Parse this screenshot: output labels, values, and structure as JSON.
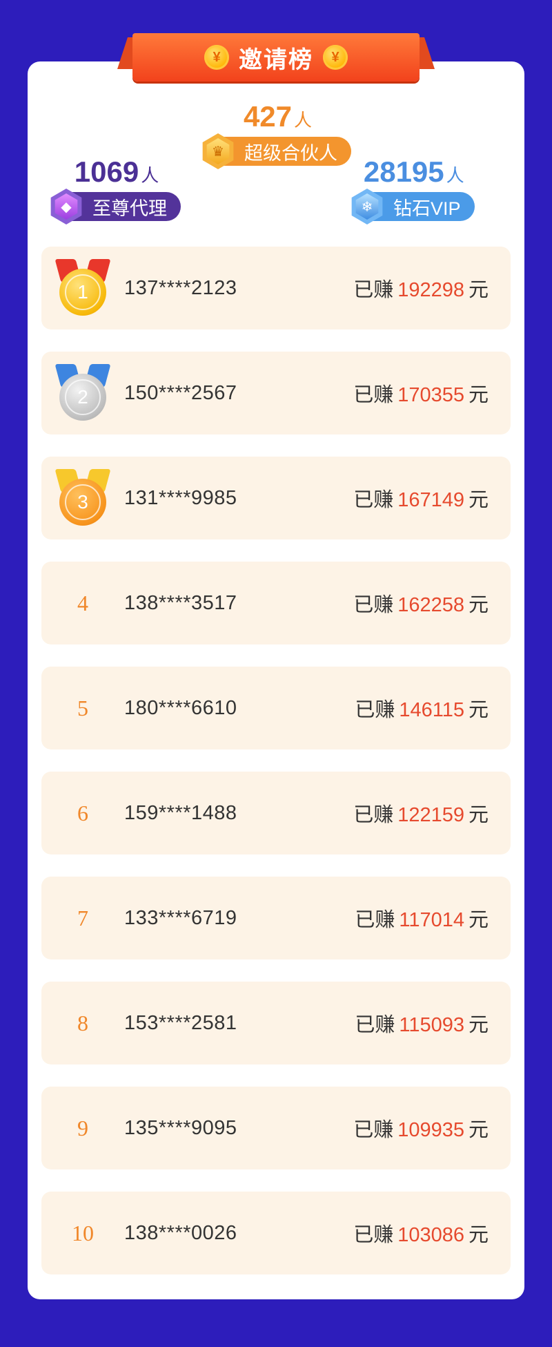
{
  "banner": {
    "title": "邀请榜",
    "coin_symbol": "¥"
  },
  "tiers": {
    "supreme": {
      "count": "1069",
      "unit": "人",
      "label": "至尊代理",
      "icon": "gem-icon"
    },
    "partner": {
      "count": "427",
      "unit": "人",
      "label": "超级合伙人",
      "icon": "crown-icon"
    },
    "diamond": {
      "count": "28195",
      "unit": "人",
      "label": "钻石VIP",
      "icon": "snowflake-icon"
    }
  },
  "earned_prefix": "已赚",
  "currency_unit": "元",
  "rankings": [
    {
      "rank": "1",
      "phone": "137****2123",
      "amount": "192298",
      "medal": "gold"
    },
    {
      "rank": "2",
      "phone": "150****2567",
      "amount": "170355",
      "medal": "silver"
    },
    {
      "rank": "3",
      "phone": "131****9985",
      "amount": "167149",
      "medal": "bronze"
    },
    {
      "rank": "4",
      "phone": "138****3517",
      "amount": "162258"
    },
    {
      "rank": "5",
      "phone": "180****6610",
      "amount": "146115"
    },
    {
      "rank": "6",
      "phone": "159****1488",
      "amount": "122159"
    },
    {
      "rank": "7",
      "phone": "133****6719",
      "amount": "117014"
    },
    {
      "rank": "8",
      "phone": "153****2581",
      "amount": "115093"
    },
    {
      "rank": "9",
      "phone": "135****9095",
      "amount": "109935"
    },
    {
      "rank": "10",
      "phone": "138****0026",
      "amount": "103086"
    }
  ],
  "colors": {
    "background": "#2d1dbb",
    "amount": "#e64a2e",
    "rank": "#f0872a",
    "row_bg": "#fdf3e6"
  }
}
